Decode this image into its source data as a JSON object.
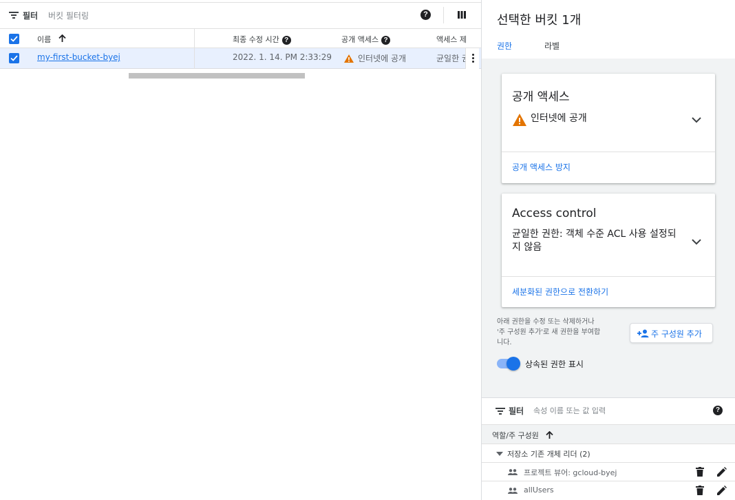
{
  "toolbar": {
    "filter_label": "필터",
    "filter_placeholder": "버킷 필터링",
    "help_glyph": "?"
  },
  "table": {
    "headers": {
      "name": "이름",
      "updated": "최종 수정 시간",
      "public_access": "공개 액세스",
      "access_control": "액세스 제"
    },
    "rows": [
      {
        "name": "my-first-bucket-byej",
        "updated": "2022. 1. 14. PM 2:33:29",
        "public_access": "인터넷에 공개",
        "access_control": "균일한 권"
      }
    ]
  },
  "panel": {
    "title": "선택한 버킷 1개",
    "tabs": [
      "권한",
      "라벨"
    ],
    "public_card": {
      "title": "공개 액세스",
      "status": "인터넷에 공개",
      "link": "공개 액세스 방지"
    },
    "access_card": {
      "title": "Access control",
      "status_line1": "균일한 권한: 객체 수준 ACL 사용 설정되",
      "status_line2": "지 않음",
      "link": "세분화된 권한으로 전환하기"
    },
    "info_line1": "아래 권한을 수정 또는 삭제하거나",
    "info_line2": "'주 구성원 추가'로 새 권한을 부여합",
    "info_line3": "니다.",
    "add_button": "주 구성원 추가",
    "toggle_label": "상속된 권한 표시",
    "toggle_on": true,
    "perm_filter_label": "필터",
    "perm_filter_placeholder": "속성 이름 또는 값 입력",
    "perm_header": "역할/주 구성원",
    "group": "저장소 기존 개체 리더 (2)",
    "members": [
      "프로젝트 뷰어: gcloud-byej",
      "allUsers"
    ]
  },
  "colors": {
    "accent": "#1a73e8",
    "warning": "#e37400",
    "selected_row": "#e8f0fe"
  }
}
